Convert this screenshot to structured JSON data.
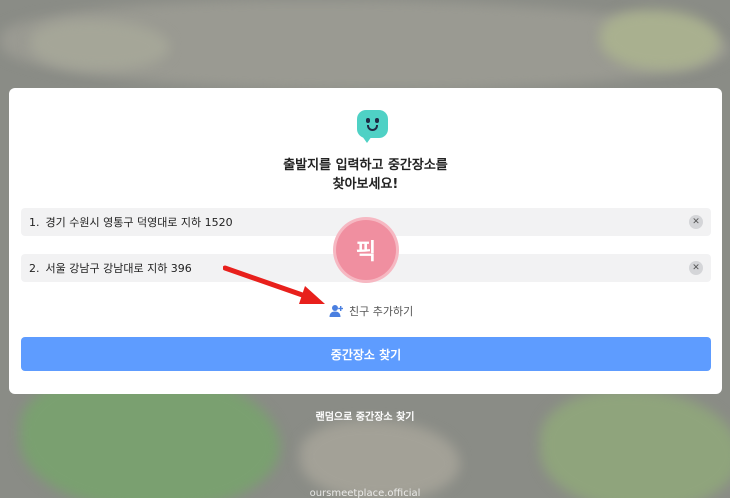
{
  "card": {
    "title_line1": "출발지를 입력하고 중간장소를",
    "title_line2": "찾아보세요!"
  },
  "inputs": [
    {
      "number": "1.",
      "value": "경기 수원시 영통구 덕영대로 지하 1520"
    },
    {
      "number": "2.",
      "value": "서울 강남구 강남대로 지하 396"
    }
  ],
  "sticker": {
    "label": "픽"
  },
  "add_friend": {
    "label": "친구 추가하기",
    "icon": "person-add-icon"
  },
  "search_button": {
    "label": "중간장소 찾기",
    "color": "#5e9cff"
  },
  "random_link": {
    "label": "랜덤으로 중간장소 찾기"
  },
  "footer": {
    "text": "oursmeetplace.official"
  },
  "colors": {
    "brand": "#4fd1c5",
    "accent": "#5e9cff",
    "arrow": "#e8201c",
    "sticker": "#f08fa0"
  }
}
